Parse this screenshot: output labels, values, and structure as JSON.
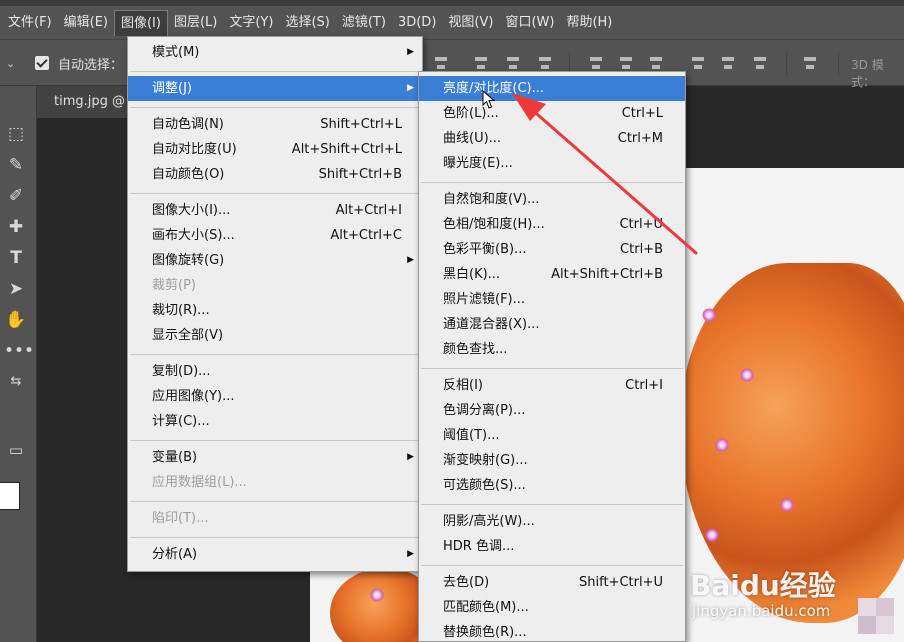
{
  "menubar": {
    "items": [
      "文件(F)",
      "编辑(E)",
      "图像(I)",
      "图层(L)",
      "文字(Y)",
      "选择(S)",
      "滤镜(T)",
      "3D(D)",
      "视图(V)",
      "窗口(W)",
      "帮助(H)"
    ],
    "active_index": 2
  },
  "options": {
    "auto_select_label": "自动选择：",
    "mode_3d_label": "3D 模式："
  },
  "document_tab": {
    "name": "timg.jpg @"
  },
  "image_menu": [
    {
      "label": "模式(M)",
      "shortcut": "",
      "submenu": true,
      "disabled": false
    },
    {
      "sep": true
    },
    {
      "label": "调整(J)",
      "shortcut": "",
      "submenu": true,
      "disabled": false,
      "highlight": true
    },
    {
      "sep": true
    },
    {
      "label": "自动色调(N)",
      "shortcut": "Shift+Ctrl+L"
    },
    {
      "label": "自动对比度(U)",
      "shortcut": "Alt+Shift+Ctrl+L"
    },
    {
      "label": "自动颜色(O)",
      "shortcut": "Shift+Ctrl+B"
    },
    {
      "sep": true
    },
    {
      "label": "图像大小(I)...",
      "shortcut": "Alt+Ctrl+I"
    },
    {
      "label": "画布大小(S)...",
      "shortcut": "Alt+Ctrl+C"
    },
    {
      "label": "图像旋转(G)",
      "shortcut": "",
      "submenu": true
    },
    {
      "label": "裁剪(P)",
      "shortcut": "",
      "disabled": true
    },
    {
      "label": "裁切(R)...",
      "shortcut": ""
    },
    {
      "label": "显示全部(V)",
      "shortcut": ""
    },
    {
      "sep": true
    },
    {
      "label": "复制(D)...",
      "shortcut": ""
    },
    {
      "label": "应用图像(Y)...",
      "shortcut": ""
    },
    {
      "label": "计算(C)...",
      "shortcut": ""
    },
    {
      "sep": true
    },
    {
      "label": "变量(B)",
      "shortcut": "",
      "submenu": true
    },
    {
      "label": "应用数据组(L)...",
      "shortcut": "",
      "disabled": true
    },
    {
      "sep": true
    },
    {
      "label": "陷印(T)...",
      "shortcut": "",
      "disabled": true
    },
    {
      "sep": true
    },
    {
      "label": "分析(A)",
      "shortcut": "",
      "submenu": true
    }
  ],
  "adjust_menu": [
    {
      "label": "亮度/对比度(C)...",
      "shortcut": "",
      "highlight": true
    },
    {
      "label": "色阶(L)...",
      "shortcut": "Ctrl+L"
    },
    {
      "label": "曲线(U)...",
      "shortcut": "Ctrl+M"
    },
    {
      "label": "曝光度(E)...",
      "shortcut": ""
    },
    {
      "sep": true
    },
    {
      "label": "自然饱和度(V)...",
      "shortcut": ""
    },
    {
      "label": "色相/饱和度(H)...",
      "shortcut": "Ctrl+U"
    },
    {
      "label": "色彩平衡(B)...",
      "shortcut": "Ctrl+B"
    },
    {
      "label": "黑白(K)...",
      "shortcut": "Alt+Shift+Ctrl+B"
    },
    {
      "label": "照片滤镜(F)...",
      "shortcut": ""
    },
    {
      "label": "通道混合器(X)...",
      "shortcut": ""
    },
    {
      "label": "颜色查找...",
      "shortcut": ""
    },
    {
      "sep": true
    },
    {
      "label": "反相(I)",
      "shortcut": "Ctrl+I"
    },
    {
      "label": "色调分离(P)...",
      "shortcut": ""
    },
    {
      "label": "阈值(T)...",
      "shortcut": ""
    },
    {
      "label": "渐变映射(G)...",
      "shortcut": ""
    },
    {
      "label": "可选颜色(S)...",
      "shortcut": ""
    },
    {
      "sep": true
    },
    {
      "label": "阴影/高光(W)...",
      "shortcut": ""
    },
    {
      "label": "HDR 色调...",
      "shortcut": ""
    },
    {
      "sep": true
    },
    {
      "label": "去色(D)",
      "shortcut": "Shift+Ctrl+U"
    },
    {
      "label": "匹配颜色(M)...",
      "shortcut": ""
    },
    {
      "label": "替换颜色(R)...",
      "shortcut": ""
    }
  ],
  "watermark": {
    "brand": "Baidu经验",
    "url": "jingyan.baidu.com"
  },
  "colors": {
    "highlight": "#3b7ed6",
    "annotation_arrow": "#ec3a3a"
  }
}
